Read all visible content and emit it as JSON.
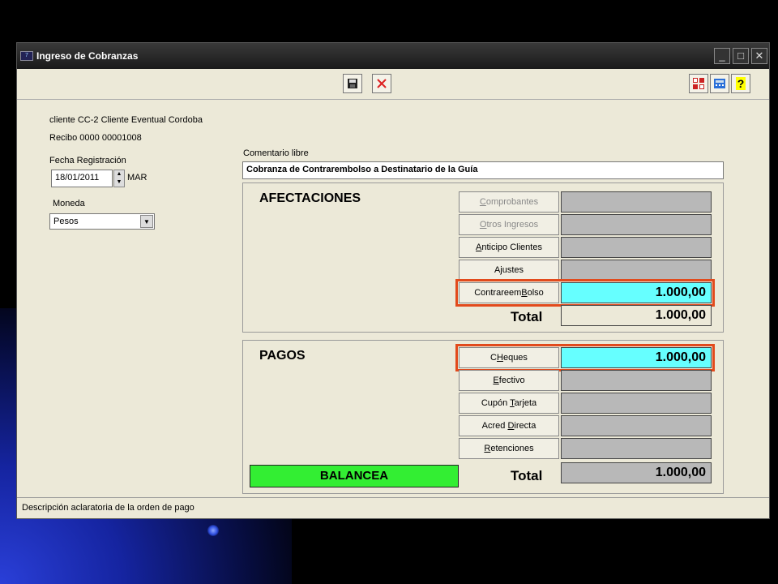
{
  "window": {
    "title": "Ingreso de Cobranzas"
  },
  "client": {
    "line": "cliente CC-2  Cliente Eventual Cordoba",
    "receipt": "Recibo 0000 00001008"
  },
  "fecha": {
    "label": "Fecha Registración",
    "value": "18/01/2011",
    "weekday": "MAR"
  },
  "moneda": {
    "label": "Moneda",
    "value": "Pesos"
  },
  "comentario": {
    "label": "Comentario libre",
    "value": "Cobranza de Contrarembolso a Destinatario de la Guía"
  },
  "afectaciones": {
    "title": "AFECTACIONES",
    "items": [
      {
        "pre": "",
        "u": "C",
        "post": "omprobantes",
        "value": ""
      },
      {
        "pre": "",
        "u": "O",
        "post": "tros Ingresos",
        "value": ""
      },
      {
        "pre": "",
        "u": "A",
        "post": "nticipo Clientes",
        "value": ""
      },
      {
        "pre": "A",
        "u": "j",
        "post": "ustes",
        "value": ""
      },
      {
        "pre": "Contrareem",
        "u": "B",
        "post": "olso",
        "value": "1.000,00"
      }
    ],
    "total_label": "Total",
    "total_value": "1.000,00"
  },
  "pagos": {
    "title": "PAGOS",
    "items": [
      {
        "pre": "C",
        "u": "H",
        "post": "eques",
        "value": "1.000,00"
      },
      {
        "pre": "",
        "u": "E",
        "post": "fectivo",
        "value": ""
      },
      {
        "pre": "Cupón ",
        "u": "T",
        "post": "arjeta",
        "value": ""
      },
      {
        "pre": "Acred ",
        "u": "D",
        "post": "irecta",
        "value": ""
      },
      {
        "pre": "",
        "u": "R",
        "post": "etenciones",
        "value": ""
      }
    ],
    "balance_label": "BALANCEA",
    "total_label": "Total",
    "total_value": "1.000,00"
  },
  "status": {
    "text": "Descripción aclaratoria de la orden de pago"
  },
  "icons": {
    "save": "save-icon",
    "cancel": "close-icon",
    "calc": "calculator-icon",
    "help": "help-icon",
    "grid": "grid-icon"
  },
  "colors": {
    "highlight": "#e24a1c",
    "cyan_field": "#66ffff",
    "balance_green": "#33ee33"
  }
}
